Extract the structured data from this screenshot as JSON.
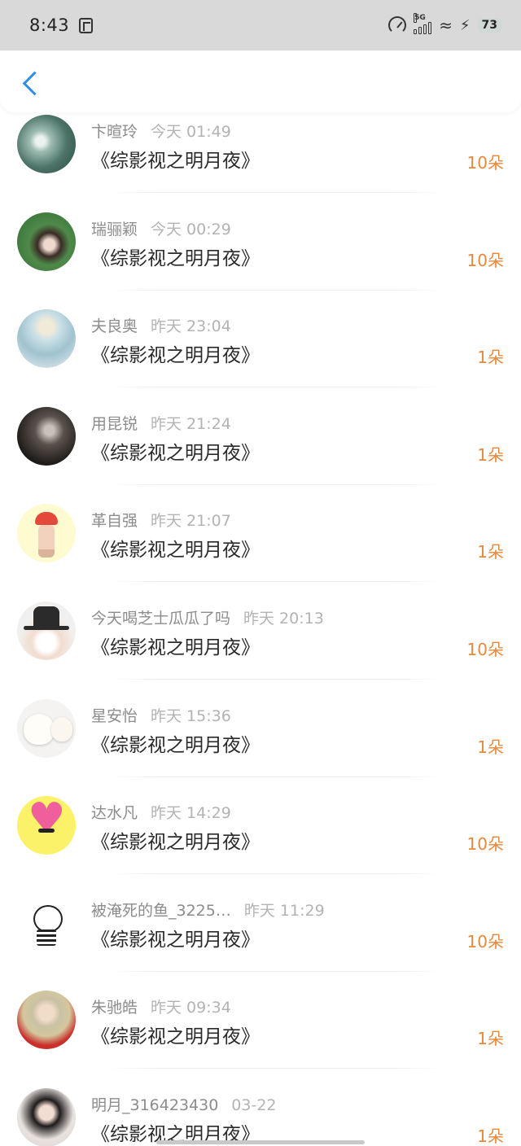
{
  "status_bar": {
    "time": "8:43",
    "network": "5G",
    "battery": "73"
  },
  "items": [
    {
      "name": "卞暄玲",
      "time": "今天 01:49",
      "title": "《综影视之明月夜》",
      "amount": "10朵"
    },
    {
      "name": "瑞骊颖",
      "time": "今天 00:29",
      "title": "《综影视之明月夜》",
      "amount": "10朵"
    },
    {
      "name": "夫良奥",
      "time": "昨天 23:04",
      "title": "《综影视之明月夜》",
      "amount": "1朵"
    },
    {
      "name": "用昆锐",
      "time": "昨天 21:24",
      "title": "《综影视之明月夜》",
      "amount": "1朵"
    },
    {
      "name": "革自强",
      "time": "昨天 21:07",
      "title": "《综影视之明月夜》",
      "amount": "1朵"
    },
    {
      "name": "今天喝芝士瓜瓜了吗",
      "time": "昨天 20:13",
      "title": "《综影视之明月夜》",
      "amount": "10朵"
    },
    {
      "name": "星安怡",
      "time": "昨天 15:36",
      "title": "《综影视之明月夜》",
      "amount": "1朵"
    },
    {
      "name": "达水凡",
      "time": "昨天 14:29",
      "title": "《综影视之明月夜》",
      "amount": "10朵"
    },
    {
      "name": "被淹死的鱼_3225…",
      "time": "昨天 11:29",
      "title": "《综影视之明月夜》",
      "amount": "10朵"
    },
    {
      "name": "朱驰皓",
      "time": "昨天 09:34",
      "title": "《综影视之明月夜》",
      "amount": "1朵"
    },
    {
      "name": "明月_316423430",
      "time": "03-22",
      "title": "《综影视之明月夜》",
      "amount": "1朵"
    }
  ],
  "colors": {
    "accent": "#2f8fe6",
    "amount": "#e6893c",
    "status_bar": "#d9d9d9"
  },
  "icons": {
    "back": "chevron-left-icon"
  }
}
